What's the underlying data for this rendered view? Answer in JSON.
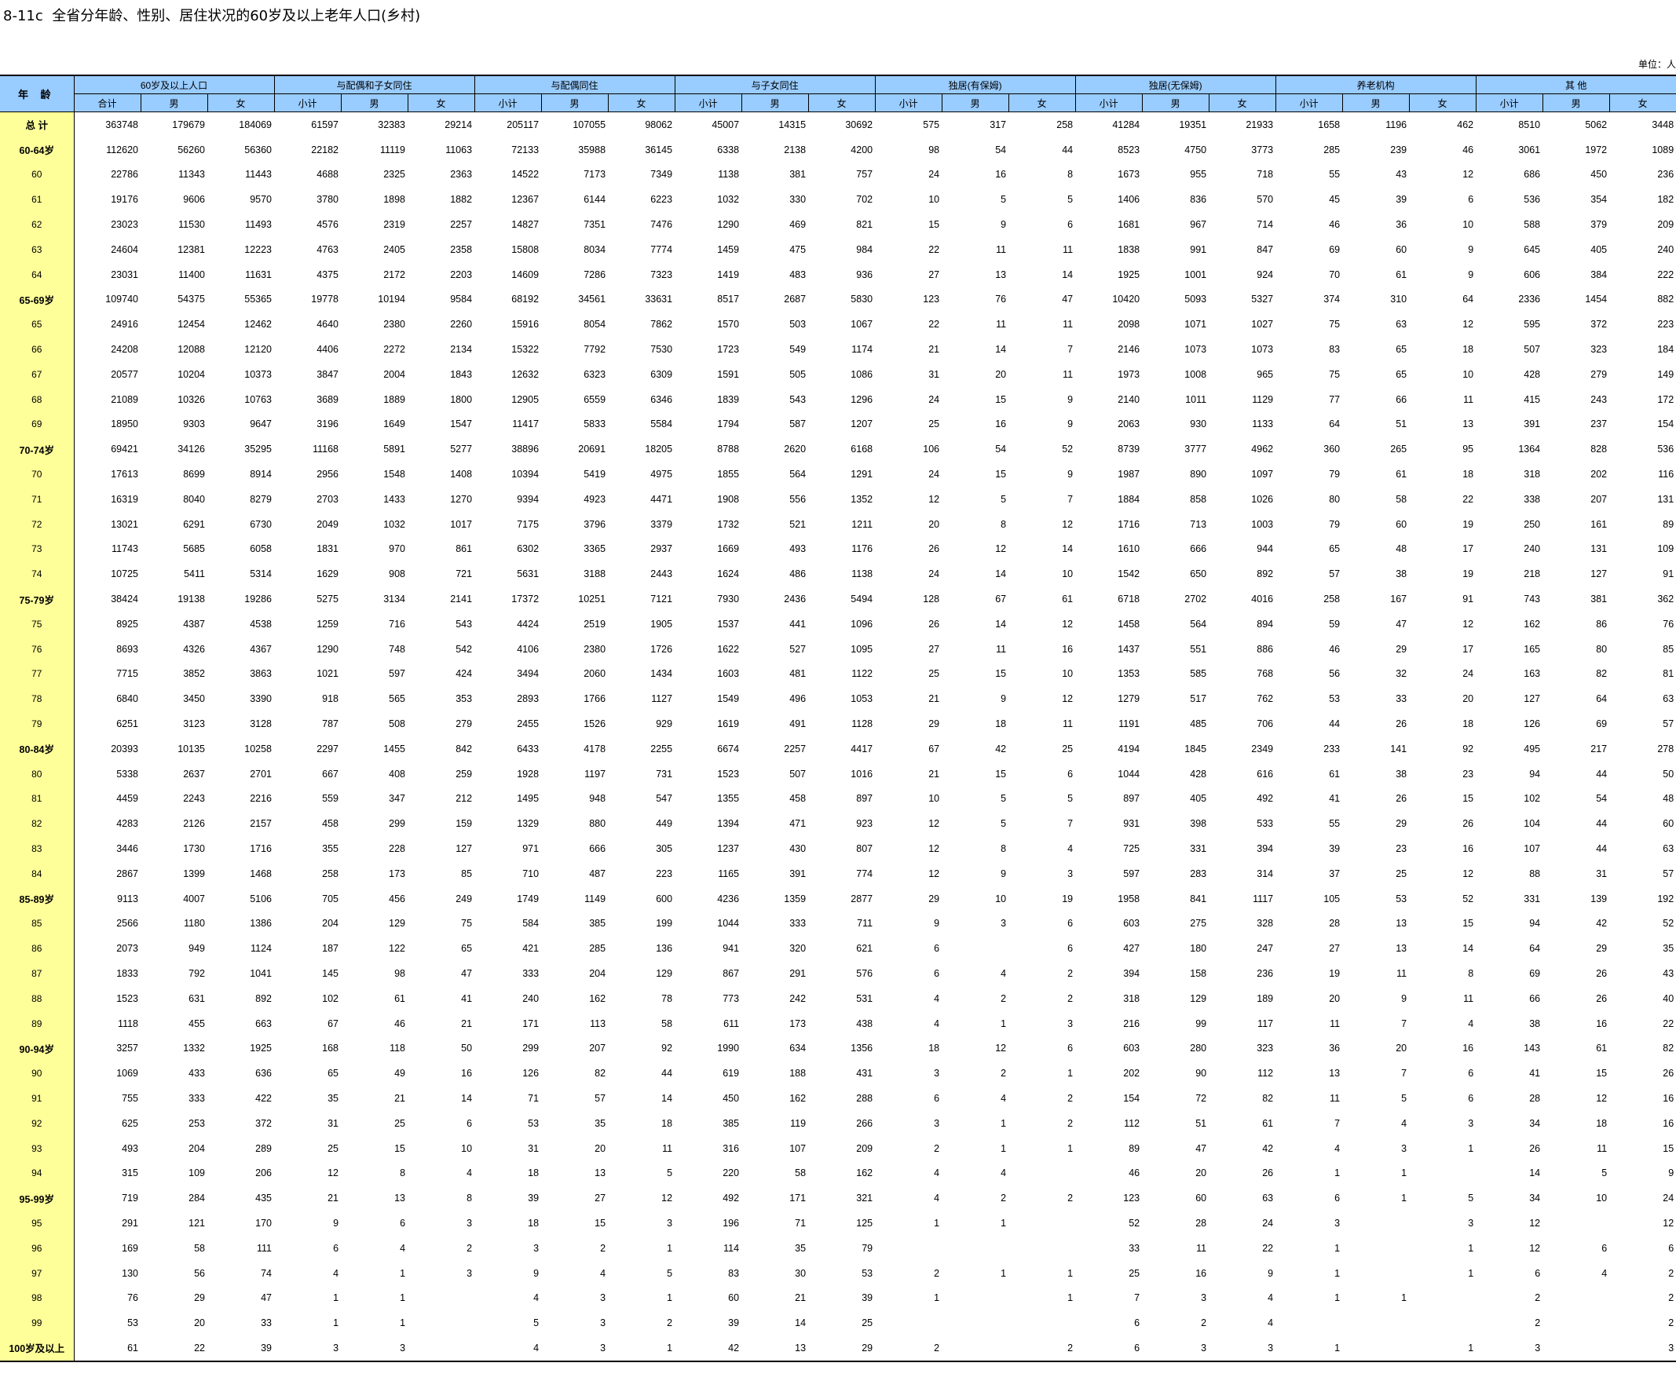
{
  "title": "8-11c  全省分年龄、性别、居住状况的60岁及以上老年人口(乡村)",
  "unit": "单位：人",
  "header": {
    "age_label": "年  龄",
    "groups": [
      "60岁及以上人口",
      "与配偶和子女同住",
      "与配偶同住",
      "与子女同住",
      "独居(有保姆)",
      "独居(无保姆)",
      "养老机构",
      "其    他"
    ],
    "sub_first": [
      "合计",
      "男",
      "女"
    ],
    "sub_other": [
      "小计",
      "男",
      "女"
    ]
  },
  "rows": [
    [
      "总  计",
      "363748",
      "179679",
      "184069",
      "61597",
      "32383",
      "29214",
      "205117",
      "107055",
      "98062",
      "45007",
      "14315",
      "30692",
      "575",
      "317",
      "258",
      "41284",
      "19351",
      "21933",
      "1658",
      "1196",
      "462",
      "8510",
      "5062",
      "3448"
    ],
    [
      "60-64岁",
      "112620",
      "56260",
      "56360",
      "22182",
      "11119",
      "11063",
      "72133",
      "35988",
      "36145",
      "6338",
      "2138",
      "4200",
      "98",
      "54",
      "44",
      "8523",
      "4750",
      "3773",
      "285",
      "239",
      "46",
      "3061",
      "1972",
      "1089"
    ],
    [
      "60",
      "22786",
      "11343",
      "11443",
      "4688",
      "2325",
      "2363",
      "14522",
      "7173",
      "7349",
      "1138",
      "381",
      "757",
      "24",
      "16",
      "8",
      "1673",
      "955",
      "718",
      "55",
      "43",
      "12",
      "686",
      "450",
      "236"
    ],
    [
      "61",
      "19176",
      "9606",
      "9570",
      "3780",
      "1898",
      "1882",
      "12367",
      "6144",
      "6223",
      "1032",
      "330",
      "702",
      "10",
      "5",
      "5",
      "1406",
      "836",
      "570",
      "45",
      "39",
      "6",
      "536",
      "354",
      "182"
    ],
    [
      "62",
      "23023",
      "11530",
      "11493",
      "4576",
      "2319",
      "2257",
      "14827",
      "7351",
      "7476",
      "1290",
      "469",
      "821",
      "15",
      "9",
      "6",
      "1681",
      "967",
      "714",
      "46",
      "36",
      "10",
      "588",
      "379",
      "209"
    ],
    [
      "63",
      "24604",
      "12381",
      "12223",
      "4763",
      "2405",
      "2358",
      "15808",
      "8034",
      "7774",
      "1459",
      "475",
      "984",
      "22",
      "11",
      "11",
      "1838",
      "991",
      "847",
      "69",
      "60",
      "9",
      "645",
      "405",
      "240"
    ],
    [
      "64",
      "23031",
      "11400",
      "11631",
      "4375",
      "2172",
      "2203",
      "14609",
      "7286",
      "7323",
      "1419",
      "483",
      "936",
      "27",
      "13",
      "14",
      "1925",
      "1001",
      "924",
      "70",
      "61",
      "9",
      "606",
      "384",
      "222"
    ],
    [
      "65-69岁",
      "109740",
      "54375",
      "55365",
      "19778",
      "10194",
      "9584",
      "68192",
      "34561",
      "33631",
      "8517",
      "2687",
      "5830",
      "123",
      "76",
      "47",
      "10420",
      "5093",
      "5327",
      "374",
      "310",
      "64",
      "2336",
      "1454",
      "882"
    ],
    [
      "65",
      "24916",
      "12454",
      "12462",
      "4640",
      "2380",
      "2260",
      "15916",
      "8054",
      "7862",
      "1570",
      "503",
      "1067",
      "22",
      "11",
      "11",
      "2098",
      "1071",
      "1027",
      "75",
      "63",
      "12",
      "595",
      "372",
      "223"
    ],
    [
      "66",
      "24208",
      "12088",
      "12120",
      "4406",
      "2272",
      "2134",
      "15322",
      "7792",
      "7530",
      "1723",
      "549",
      "1174",
      "21",
      "14",
      "7",
      "2146",
      "1073",
      "1073",
      "83",
      "65",
      "18",
      "507",
      "323",
      "184"
    ],
    [
      "67",
      "20577",
      "10204",
      "10373",
      "3847",
      "2004",
      "1843",
      "12632",
      "6323",
      "6309",
      "1591",
      "505",
      "1086",
      "31",
      "20",
      "11",
      "1973",
      "1008",
      "965",
      "75",
      "65",
      "10",
      "428",
      "279",
      "149"
    ],
    [
      "68",
      "21089",
      "10326",
      "10763",
      "3689",
      "1889",
      "1800",
      "12905",
      "6559",
      "6346",
      "1839",
      "543",
      "1296",
      "24",
      "15",
      "9",
      "2140",
      "1011",
      "1129",
      "77",
      "66",
      "11",
      "415",
      "243",
      "172"
    ],
    [
      "69",
      "18950",
      "9303",
      "9647",
      "3196",
      "1649",
      "1547",
      "11417",
      "5833",
      "5584",
      "1794",
      "587",
      "1207",
      "25",
      "16",
      "9",
      "2063",
      "930",
      "1133",
      "64",
      "51",
      "13",
      "391",
      "237",
      "154"
    ],
    [
      "70-74岁",
      "69421",
      "34126",
      "35295",
      "11168",
      "5891",
      "5277",
      "38896",
      "20691",
      "18205",
      "8788",
      "2620",
      "6168",
      "106",
      "54",
      "52",
      "8739",
      "3777",
      "4962",
      "360",
      "265",
      "95",
      "1364",
      "828",
      "536"
    ],
    [
      "70",
      "17613",
      "8699",
      "8914",
      "2956",
      "1548",
      "1408",
      "10394",
      "5419",
      "4975",
      "1855",
      "564",
      "1291",
      "24",
      "15",
      "9",
      "1987",
      "890",
      "1097",
      "79",
      "61",
      "18",
      "318",
      "202",
      "116"
    ],
    [
      "71",
      "16319",
      "8040",
      "8279",
      "2703",
      "1433",
      "1270",
      "9394",
      "4923",
      "4471",
      "1908",
      "556",
      "1352",
      "12",
      "5",
      "7",
      "1884",
      "858",
      "1026",
      "80",
      "58",
      "22",
      "338",
      "207",
      "131"
    ],
    [
      "72",
      "13021",
      "6291",
      "6730",
      "2049",
      "1032",
      "1017",
      "7175",
      "3796",
      "3379",
      "1732",
      "521",
      "1211",
      "20",
      "8",
      "12",
      "1716",
      "713",
      "1003",
      "79",
      "60",
      "19",
      "250",
      "161",
      "89"
    ],
    [
      "73",
      "11743",
      "5685",
      "6058",
      "1831",
      "970",
      "861",
      "6302",
      "3365",
      "2937",
      "1669",
      "493",
      "1176",
      "26",
      "12",
      "14",
      "1610",
      "666",
      "944",
      "65",
      "48",
      "17",
      "240",
      "131",
      "109"
    ],
    [
      "74",
      "10725",
      "5411",
      "5314",
      "1629",
      "908",
      "721",
      "5631",
      "3188",
      "2443",
      "1624",
      "486",
      "1138",
      "24",
      "14",
      "10",
      "1542",
      "650",
      "892",
      "57",
      "38",
      "19",
      "218",
      "127",
      "91"
    ],
    [
      "75-79岁",
      "38424",
      "19138",
      "19286",
      "5275",
      "3134",
      "2141",
      "17372",
      "10251",
      "7121",
      "7930",
      "2436",
      "5494",
      "128",
      "67",
      "61",
      "6718",
      "2702",
      "4016",
      "258",
      "167",
      "91",
      "743",
      "381",
      "362"
    ],
    [
      "75",
      "8925",
      "4387",
      "4538",
      "1259",
      "716",
      "543",
      "4424",
      "2519",
      "1905",
      "1537",
      "441",
      "1096",
      "26",
      "14",
      "12",
      "1458",
      "564",
      "894",
      "59",
      "47",
      "12",
      "162",
      "86",
      "76"
    ],
    [
      "76",
      "8693",
      "4326",
      "4367",
      "1290",
      "748",
      "542",
      "4106",
      "2380",
      "1726",
      "1622",
      "527",
      "1095",
      "27",
      "11",
      "16",
      "1437",
      "551",
      "886",
      "46",
      "29",
      "17",
      "165",
      "80",
      "85"
    ],
    [
      "77",
      "7715",
      "3852",
      "3863",
      "1021",
      "597",
      "424",
      "3494",
      "2060",
      "1434",
      "1603",
      "481",
      "1122",
      "25",
      "15",
      "10",
      "1353",
      "585",
      "768",
      "56",
      "32",
      "24",
      "163",
      "82",
      "81"
    ],
    [
      "78",
      "6840",
      "3450",
      "3390",
      "918",
      "565",
      "353",
      "2893",
      "1766",
      "1127",
      "1549",
      "496",
      "1053",
      "21",
      "9",
      "12",
      "1279",
      "517",
      "762",
      "53",
      "33",
      "20",
      "127",
      "64",
      "63"
    ],
    [
      "79",
      "6251",
      "3123",
      "3128",
      "787",
      "508",
      "279",
      "2455",
      "1526",
      "929",
      "1619",
      "491",
      "1128",
      "29",
      "18",
      "11",
      "1191",
      "485",
      "706",
      "44",
      "26",
      "18",
      "126",
      "69",
      "57"
    ],
    [
      "80-84岁",
      "20393",
      "10135",
      "10258",
      "2297",
      "1455",
      "842",
      "6433",
      "4178",
      "2255",
      "6674",
      "2257",
      "4417",
      "67",
      "42",
      "25",
      "4194",
      "1845",
      "2349",
      "233",
      "141",
      "92",
      "495",
      "217",
      "278"
    ],
    [
      "80",
      "5338",
      "2637",
      "2701",
      "667",
      "408",
      "259",
      "1928",
      "1197",
      "731",
      "1523",
      "507",
      "1016",
      "21",
      "15",
      "6",
      "1044",
      "428",
      "616",
      "61",
      "38",
      "23",
      "94",
      "44",
      "50"
    ],
    [
      "81",
      "4459",
      "2243",
      "2216",
      "559",
      "347",
      "212",
      "1495",
      "948",
      "547",
      "1355",
      "458",
      "897",
      "10",
      "5",
      "5",
      "897",
      "405",
      "492",
      "41",
      "26",
      "15",
      "102",
      "54",
      "48"
    ],
    [
      "82",
      "4283",
      "2126",
      "2157",
      "458",
      "299",
      "159",
      "1329",
      "880",
      "449",
      "1394",
      "471",
      "923",
      "12",
      "5",
      "7",
      "931",
      "398",
      "533",
      "55",
      "29",
      "26",
      "104",
      "44",
      "60"
    ],
    [
      "83",
      "3446",
      "1730",
      "1716",
      "355",
      "228",
      "127",
      "971",
      "666",
      "305",
      "1237",
      "430",
      "807",
      "12",
      "8",
      "4",
      "725",
      "331",
      "394",
      "39",
      "23",
      "16",
      "107",
      "44",
      "63"
    ],
    [
      "84",
      "2867",
      "1399",
      "1468",
      "258",
      "173",
      "85",
      "710",
      "487",
      "223",
      "1165",
      "391",
      "774",
      "12",
      "9",
      "3",
      "597",
      "283",
      "314",
      "37",
      "25",
      "12",
      "88",
      "31",
      "57"
    ],
    [
      "85-89岁",
      "9113",
      "4007",
      "5106",
      "705",
      "456",
      "249",
      "1749",
      "1149",
      "600",
      "4236",
      "1359",
      "2877",
      "29",
      "10",
      "19",
      "1958",
      "841",
      "1117",
      "105",
      "53",
      "52",
      "331",
      "139",
      "192"
    ],
    [
      "85",
      "2566",
      "1180",
      "1386",
      "204",
      "129",
      "75",
      "584",
      "385",
      "199",
      "1044",
      "333",
      "711",
      "9",
      "3",
      "6",
      "603",
      "275",
      "328",
      "28",
      "13",
      "15",
      "94",
      "42",
      "52"
    ],
    [
      "86",
      "2073",
      "949",
      "1124",
      "187",
      "122",
      "65",
      "421",
      "285",
      "136",
      "941",
      "320",
      "621",
      "6",
      "",
      "6",
      "427",
      "180",
      "247",
      "27",
      "13",
      "14",
      "64",
      "29",
      "35"
    ],
    [
      "87",
      "1833",
      "792",
      "1041",
      "145",
      "98",
      "47",
      "333",
      "204",
      "129",
      "867",
      "291",
      "576",
      "6",
      "4",
      "2",
      "394",
      "158",
      "236",
      "19",
      "11",
      "8",
      "69",
      "26",
      "43"
    ],
    [
      "88",
      "1523",
      "631",
      "892",
      "102",
      "61",
      "41",
      "240",
      "162",
      "78",
      "773",
      "242",
      "531",
      "4",
      "2",
      "2",
      "318",
      "129",
      "189",
      "20",
      "9",
      "11",
      "66",
      "26",
      "40"
    ],
    [
      "89",
      "1118",
      "455",
      "663",
      "67",
      "46",
      "21",
      "171",
      "113",
      "58",
      "611",
      "173",
      "438",
      "4",
      "1",
      "3",
      "216",
      "99",
      "117",
      "11",
      "7",
      "4",
      "38",
      "16",
      "22"
    ],
    [
      "90-94岁",
      "3257",
      "1332",
      "1925",
      "168",
      "118",
      "50",
      "299",
      "207",
      "92",
      "1990",
      "634",
      "1356",
      "18",
      "12",
      "6",
      "603",
      "280",
      "323",
      "36",
      "20",
      "16",
      "143",
      "61",
      "82"
    ],
    [
      "90",
      "1069",
      "433",
      "636",
      "65",
      "49",
      "16",
      "126",
      "82",
      "44",
      "619",
      "188",
      "431",
      "3",
      "2",
      "1",
      "202",
      "90",
      "112",
      "13",
      "7",
      "6",
      "41",
      "15",
      "26"
    ],
    [
      "91",
      "755",
      "333",
      "422",
      "35",
      "21",
      "14",
      "71",
      "57",
      "14",
      "450",
      "162",
      "288",
      "6",
      "4",
      "2",
      "154",
      "72",
      "82",
      "11",
      "5",
      "6",
      "28",
      "12",
      "16"
    ],
    [
      "92",
      "625",
      "253",
      "372",
      "31",
      "25",
      "6",
      "53",
      "35",
      "18",
      "385",
      "119",
      "266",
      "3",
      "1",
      "2",
      "112",
      "51",
      "61",
      "7",
      "4",
      "3",
      "34",
      "18",
      "16"
    ],
    [
      "93",
      "493",
      "204",
      "289",
      "25",
      "15",
      "10",
      "31",
      "20",
      "11",
      "316",
      "107",
      "209",
      "2",
      "1",
      "1",
      "89",
      "47",
      "42",
      "4",
      "3",
      "1",
      "26",
      "11",
      "15"
    ],
    [
      "94",
      "315",
      "109",
      "206",
      "12",
      "8",
      "4",
      "18",
      "13",
      "5",
      "220",
      "58",
      "162",
      "4",
      "4",
      "",
      "46",
      "20",
      "26",
      "1",
      "1",
      "",
      "14",
      "5",
      "9"
    ],
    [
      "95-99岁",
      "719",
      "284",
      "435",
      "21",
      "13",
      "8",
      "39",
      "27",
      "12",
      "492",
      "171",
      "321",
      "4",
      "2",
      "2",
      "123",
      "60",
      "63",
      "6",
      "1",
      "5",
      "34",
      "10",
      "24"
    ],
    [
      "95",
      "291",
      "121",
      "170",
      "9",
      "6",
      "3",
      "18",
      "15",
      "3",
      "196",
      "71",
      "125",
      "1",
      "1",
      "",
      "52",
      "28",
      "24",
      "3",
      "",
      "3",
      "12",
      "",
      "12"
    ],
    [
      "96",
      "169",
      "58",
      "111",
      "6",
      "4",
      "2",
      "3",
      "2",
      "1",
      "114",
      "35",
      "79",
      "",
      "",
      "",
      "33",
      "11",
      "22",
      "1",
      "",
      "1",
      "12",
      "6",
      "6"
    ],
    [
      "97",
      "130",
      "56",
      "74",
      "4",
      "1",
      "3",
      "9",
      "4",
      "5",
      "83",
      "30",
      "53",
      "2",
      "1",
      "1",
      "25",
      "16",
      "9",
      "1",
      "",
      "1",
      "6",
      "4",
      "2"
    ],
    [
      "98",
      "76",
      "29",
      "47",
      "1",
      "1",
      "",
      "4",
      "3",
      "1",
      "60",
      "21",
      "39",
      "1",
      "",
      "1",
      "7",
      "3",
      "4",
      "1",
      "1",
      "",
      "2",
      "",
      "2"
    ],
    [
      "99",
      "53",
      "20",
      "33",
      "1",
      "1",
      "",
      "5",
      "3",
      "2",
      "39",
      "14",
      "25",
      "",
      "",
      "",
      "6",
      "2",
      "4",
      "",
      "",
      "",
      "2",
      "",
      "2"
    ],
    [
      "100岁及以上",
      "61",
      "22",
      "39",
      "3",
      "3",
      "",
      "4",
      "3",
      "1",
      "42",
      "13",
      "29",
      "2",
      "",
      "2",
      "6",
      "3",
      "3",
      "1",
      "",
      "1",
      "3",
      "",
      "3"
    ]
  ]
}
